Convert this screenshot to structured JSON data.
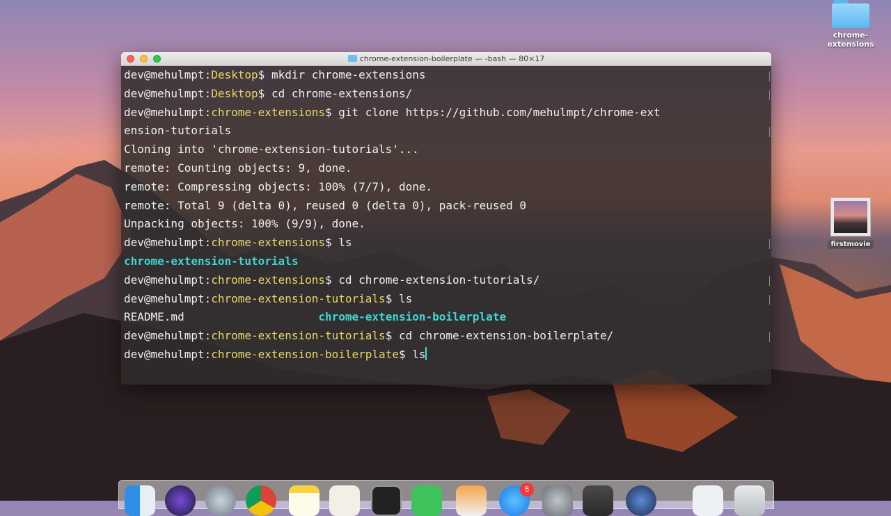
{
  "window": {
    "title": "chrome-extension-boilerplate — -bash — 80×17"
  },
  "desktop": {
    "folder_label_1": "chrome-",
    "folder_label_2": "extensions",
    "movie_label": "firstmovie"
  },
  "terminal": {
    "lines": [
      {
        "user": "dev@mehulmpt:",
        "path": "Desktop",
        "cmd": "$ mkdir chrome-extensions"
      },
      {
        "user": "dev@mehulmpt:",
        "path": "Desktop",
        "cmd": "$ cd chrome-extensions/"
      },
      {
        "user": "dev@mehulmpt:",
        "path": "chrome-extensions",
        "cmd": "$ git clone https://github.com/mehulmpt/chrome-ext"
      },
      {
        "text": "ension-tutorials"
      },
      {
        "text": "Cloning into 'chrome-extension-tutorials'..."
      },
      {
        "text": "remote: Counting objects: 9, done."
      },
      {
        "text": "remote: Compressing objects: 100% (7/7), done."
      },
      {
        "text": "remote: Total 9 (delta 0), reused 0 (delta 0), pack-reused 0"
      },
      {
        "text": "Unpacking objects: 100% (9/9), done."
      },
      {
        "user": "dev@mehulmpt:",
        "path": "chrome-extensions",
        "cmd": "$ ls"
      },
      {
        "dir": "chrome-extension-tutorials"
      },
      {
        "user": "dev@mehulmpt:",
        "path": "chrome-extensions",
        "cmd": "$ cd chrome-extension-tutorials/"
      },
      {
        "user": "dev@mehulmpt:",
        "path": "chrome-extension-tutorials",
        "cmd": "$ ls"
      },
      {
        "file": "README.md",
        "pad": "                    ",
        "dir": "chrome-extension-boilerplate"
      },
      {
        "user": "dev@mehulmpt:",
        "path": "chrome-extension-tutorials",
        "cmd": "$ cd chrome-extension-boilerplate/"
      },
      {
        "user": "dev@mehulmpt:",
        "path": "chrome-extension-boilerplate",
        "cmd": "$ ls"
      }
    ]
  },
  "dock": {
    "app_store_badge": "5",
    "items": [
      "finder-icon",
      "siri-icon",
      "launchpad-icon",
      "chrome-icon",
      "notes-icon",
      "contacts-icon",
      "terminal-icon",
      "facetime-icon",
      "pages-icon",
      "app-store-icon",
      "system-preferences-icon",
      "sublime-text-icon",
      "quicktime-icon",
      "downloads-icon",
      "trash-icon"
    ]
  },
  "colors": {
    "prompt_path": "#e8d86a",
    "directory": "#3fd6d2",
    "terminal_bg": "#302c2c"
  }
}
